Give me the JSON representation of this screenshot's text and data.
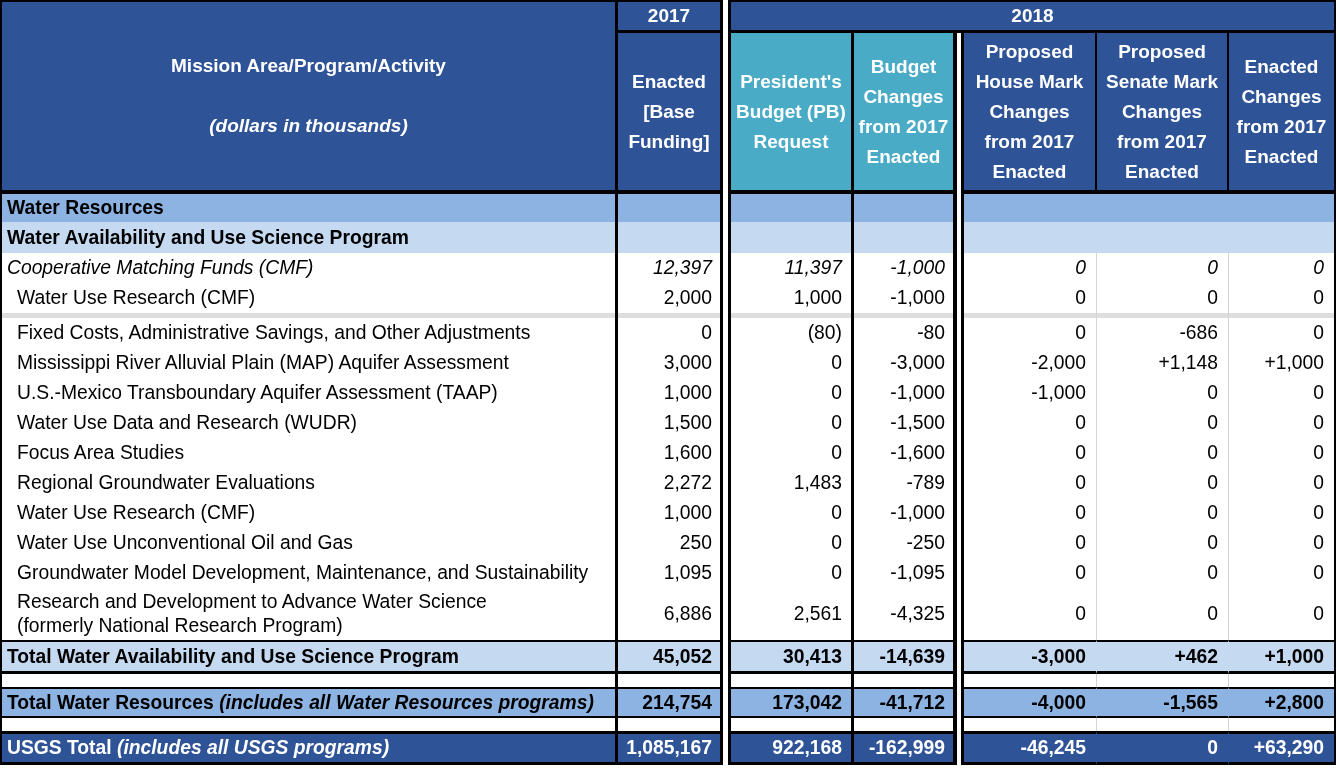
{
  "header": {
    "title": "Mission Area/Program/Activity",
    "subtitle": "(dollars in thousands)"
  },
  "column_groups": [
    {
      "year": "2017",
      "columns": [
        {
          "label": "Enacted [Base Funding]",
          "kind": "base"
        }
      ]
    },
    {
      "year": "2018",
      "columns": [
        {
          "label": "President's Budget (PB) Request",
          "kind": "request"
        },
        {
          "label": "Budget Changes from 2017 Enacted",
          "kind": "request"
        },
        {
          "label": "Proposed House Mark Changes from 2017 Enacted",
          "kind": "congress"
        },
        {
          "label": "Proposed Senate Mark Changes from 2017 Enacted",
          "kind": "congress"
        },
        {
          "label": "Enacted Changes from 2017 Enacted",
          "kind": "congress"
        }
      ]
    }
  ],
  "rows": [
    {
      "kind": "section",
      "label": "Water Resources"
    },
    {
      "kind": "program",
      "label": "Water Availability and Use Science Program"
    },
    {
      "kind": "subtotal",
      "label": "Cooperative Matching Funds (CMF)",
      "values": [
        "12,397",
        "11,397",
        "-1,000",
        "0",
        "0",
        "0"
      ]
    },
    {
      "kind": "item",
      "label": "Water Use Research (CMF)",
      "values": [
        "2,000",
        "1,000",
        "-1,000",
        "0",
        "0",
        "0"
      ]
    },
    {
      "kind": "separator"
    },
    {
      "kind": "item",
      "label": "Fixed Costs, Administrative Savings, and Other Adjustments",
      "values": [
        "0",
        "(80)",
        "-80",
        "0",
        "-686",
        "0"
      ]
    },
    {
      "kind": "item",
      "label": "Mississippi River Alluvial Plain (MAP) Aquifer Assessment",
      "values": [
        "3,000",
        "0",
        "-3,000",
        "-2,000",
        "+1,148",
        "+1,000"
      ]
    },
    {
      "kind": "item",
      "label": "U.S.-Mexico Transboundary Aquifer Assessment (TAAP)",
      "values": [
        "1,000",
        "0",
        "-1,000",
        "-1,000",
        "0",
        "0"
      ]
    },
    {
      "kind": "item",
      "label": "Water Use Data and Research (WUDR)",
      "values": [
        "1,500",
        "0",
        "-1,500",
        "0",
        "0",
        "0"
      ]
    },
    {
      "kind": "item",
      "label": "Focus Area Studies",
      "values": [
        "1,600",
        "0",
        "-1,600",
        "0",
        "0",
        "0"
      ]
    },
    {
      "kind": "item",
      "label": "Regional Groundwater Evaluations",
      "values": [
        "2,272",
        "1,483",
        "-789",
        "0",
        "0",
        "0"
      ]
    },
    {
      "kind": "item",
      "label": "Water Use Research (CMF)",
      "values": [
        "1,000",
        "0",
        "-1,000",
        "0",
        "0",
        "0"
      ]
    },
    {
      "kind": "item",
      "label": "Water Use Unconventional Oil and Gas",
      "values": [
        "250",
        "0",
        "-250",
        "0",
        "0",
        "0"
      ]
    },
    {
      "kind": "item",
      "label": "Groundwater Model Development, Maintenance, and Sustainability",
      "values": [
        "1,095",
        "0",
        "-1,095",
        "0",
        "0",
        "0"
      ]
    },
    {
      "kind": "item",
      "label": "Research and Development to Advance Water Science",
      "note": "(formerly National Research Program)",
      "values": [
        "6,886",
        "2,561",
        "-4,325",
        "0",
        "0",
        "0"
      ]
    },
    {
      "kind": "total",
      "label": "Total Water Availability and Use Science Program",
      "values": [
        "45,052",
        "30,413",
        "-14,639",
        "-3,000",
        "+462",
        "+1,000"
      ]
    },
    {
      "kind": "blank"
    },
    {
      "kind": "major_total",
      "label": "Total Water Resources *(includes all Water Resources programs)*",
      "values": [
        "214,754",
        "173,042",
        "-41,712",
        "-4,000",
        "-1,565",
        "+2,800"
      ]
    },
    {
      "kind": "blank"
    },
    {
      "kind": "grand_total",
      "label": "USGS Total *(includes all USGS programs)*",
      "values": [
        "1,085,167",
        "922,168",
        "-162,999",
        "-46,245",
        "0",
        "+63,290"
      ]
    }
  ]
}
